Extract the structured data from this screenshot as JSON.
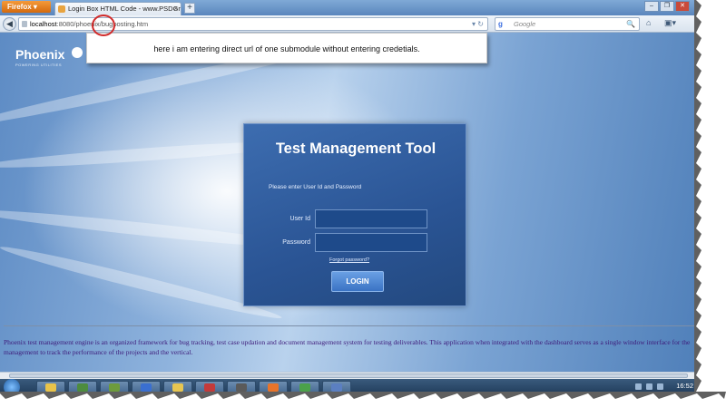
{
  "browser": {
    "app_button": "Firefox",
    "tab_title": "Login Box HTML Code - www.PSDGraph...",
    "url_host": "localhost",
    "url_rest": ":8080/phoenix/bugposting.htm",
    "search_placeholder": "Google"
  },
  "callout": {
    "text": "here i am entering direct url of one submodule without entering credetials."
  },
  "page": {
    "logo_name": "Phoenix",
    "logo_tagline": "POWERING UTILITIES",
    "login": {
      "title": "Test Management Tool",
      "prompt": "Please enter User Id and Password",
      "userid_label": "User Id",
      "password_label": "Password",
      "userid_value": "",
      "password_value": "",
      "forgot_link": "Forgot password?",
      "login_button": "LOGIN"
    },
    "description": "Phoenix test management engine is an organized framework for bug tracking, test case updation and document management system for testing deliverables. This application when integrated with the dashboard serves as a single window interface for the management to track the performance of the projects and the vertical."
  },
  "taskbar": {
    "clock": "16:52",
    "items": [
      {
        "icon": "folder-icon",
        "color": "#e8c34a"
      },
      {
        "icon": "media-icon",
        "color": "#4d8c3e"
      },
      {
        "icon": "app-icon",
        "color": "#6d9b3c"
      },
      {
        "icon": "globe-icon",
        "color": "#3a6fd0"
      },
      {
        "icon": "folder-icon",
        "color": "#e7c651"
      },
      {
        "icon": "pdf-icon",
        "color": "#c43a3a"
      },
      {
        "icon": "app-icon",
        "color": "#5a5a5a"
      },
      {
        "icon": "firefox-icon",
        "color": "#e8742a"
      },
      {
        "icon": "chat-icon",
        "color": "#4ba14a"
      },
      {
        "icon": "doc-icon",
        "color": "#5b7fc1"
      }
    ]
  }
}
